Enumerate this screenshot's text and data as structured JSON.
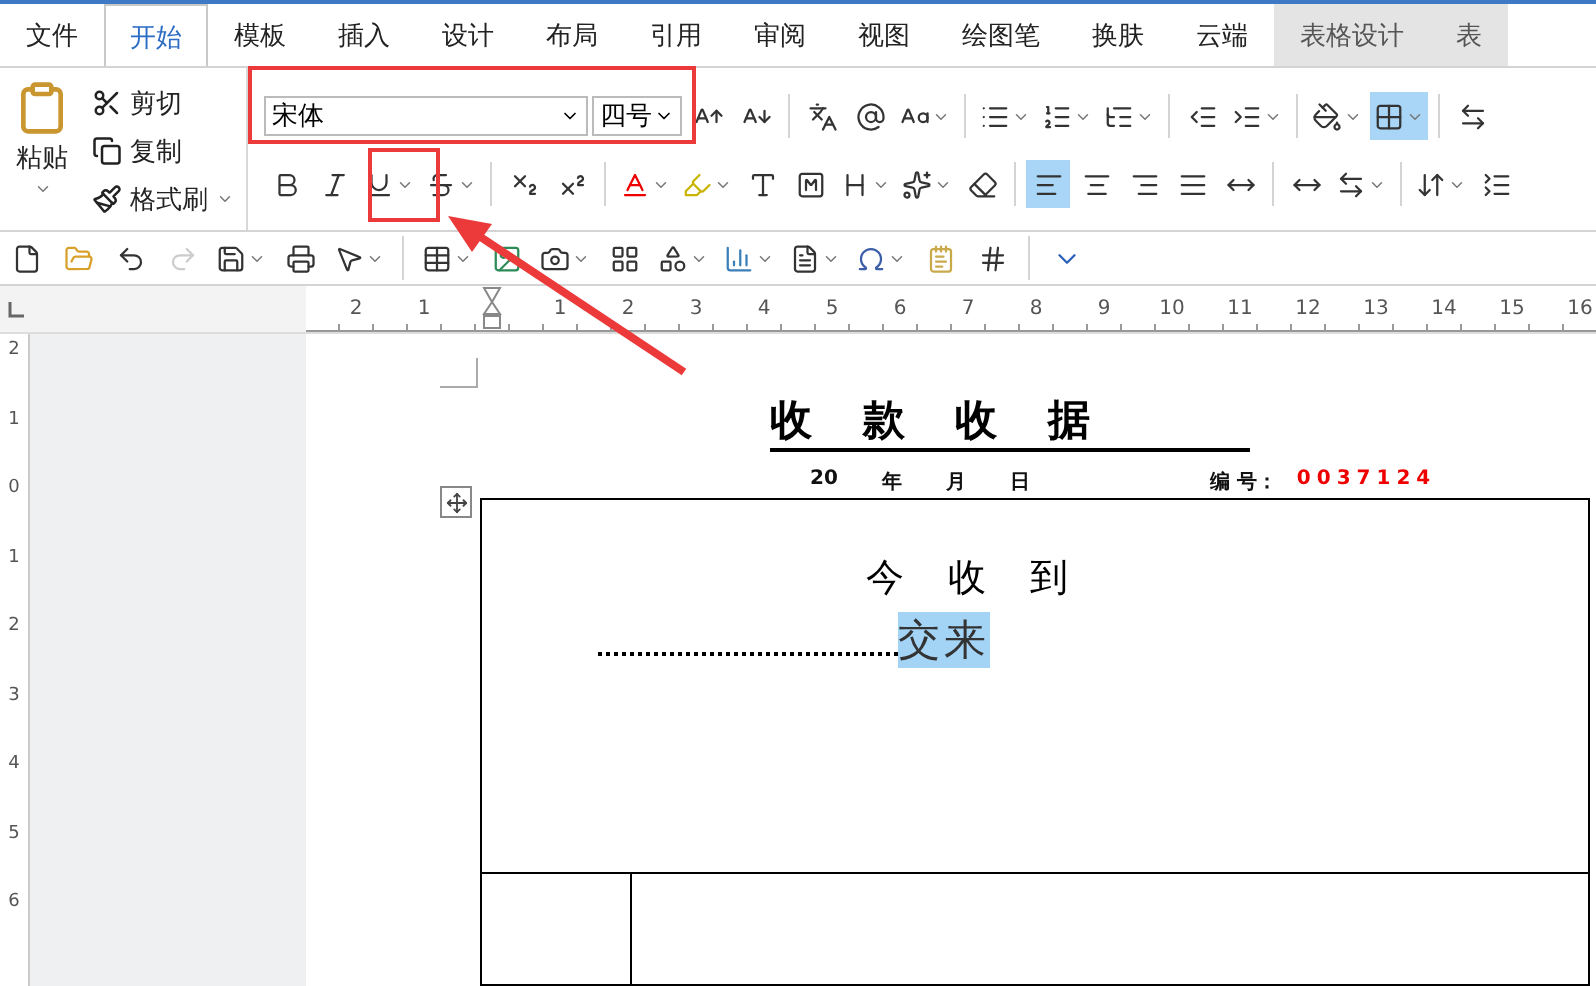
{
  "tabs": [
    {
      "label": "文件",
      "selected": false,
      "context": false
    },
    {
      "label": "开始",
      "selected": true,
      "context": false
    },
    {
      "label": "模板",
      "selected": false,
      "context": false
    },
    {
      "label": "插入",
      "selected": false,
      "context": false
    },
    {
      "label": "设计",
      "selected": false,
      "context": false
    },
    {
      "label": "布局",
      "selected": false,
      "context": false
    },
    {
      "label": "引用",
      "selected": false,
      "context": false
    },
    {
      "label": "审阅",
      "selected": false,
      "context": false
    },
    {
      "label": "视图",
      "selected": false,
      "context": false
    },
    {
      "label": "绘图笔",
      "selected": false,
      "context": false
    },
    {
      "label": "换肤",
      "selected": false,
      "context": false
    },
    {
      "label": "云端",
      "selected": false,
      "context": false
    },
    {
      "label": "表格设计",
      "selected": false,
      "context": true
    },
    {
      "label": "表",
      "selected": false,
      "context": true
    }
  ],
  "clipboard": {
    "paste": "粘贴",
    "cut": "剪切",
    "copy": "复制",
    "format_painter": "格式刷"
  },
  "font": {
    "name": "宋体",
    "size": "四号"
  },
  "tools_row1": [
    {
      "kind": "grow",
      "on": false,
      "dropdown": false
    },
    {
      "kind": "shrink",
      "on": false,
      "dropdown": false
    },
    {
      "kind": "sep"
    },
    {
      "kind": "phonetic",
      "on": false,
      "dropdown": false
    },
    {
      "kind": "circled",
      "on": false,
      "dropdown": false
    },
    {
      "kind": "case",
      "on": false,
      "dropdown": true
    },
    {
      "kind": "sep"
    },
    {
      "kind": "bullets",
      "on": false,
      "dropdown": true
    },
    {
      "kind": "numbering",
      "on": false,
      "dropdown": true
    },
    {
      "kind": "multilevel",
      "on": false,
      "dropdown": true
    },
    {
      "kind": "sep"
    },
    {
      "kind": "outdent",
      "on": false,
      "dropdown": false
    },
    {
      "kind": "indent",
      "on": false,
      "dropdown": true
    },
    {
      "kind": "sep"
    },
    {
      "kind": "shading",
      "on": false,
      "dropdown": true
    },
    {
      "kind": "borders",
      "on": true,
      "dropdown": true
    },
    {
      "kind": "sep"
    },
    {
      "kind": "tabs",
      "on": false,
      "dropdown": false
    }
  ],
  "tools_row2": [
    {
      "kind": "bold",
      "on": false,
      "dropdown": false
    },
    {
      "kind": "italic",
      "on": false,
      "dropdown": false
    },
    {
      "kind": "underline",
      "on": false,
      "dropdown": true
    },
    {
      "kind": "strike",
      "on": false,
      "dropdown": true
    },
    {
      "kind": "sep"
    },
    {
      "kind": "subscript",
      "on": false,
      "dropdown": false
    },
    {
      "kind": "superscript",
      "on": false,
      "dropdown": false
    },
    {
      "kind": "sep"
    },
    {
      "kind": "font-color",
      "on": false,
      "dropdown": true
    },
    {
      "kind": "highlight",
      "on": false,
      "dropdown": true
    },
    {
      "kind": "char-shading",
      "on": false,
      "dropdown": false
    },
    {
      "kind": "char-border",
      "on": false,
      "dropdown": false
    },
    {
      "kind": "emphasis",
      "on": false,
      "dropdown": true
    },
    {
      "kind": "effects",
      "on": false,
      "dropdown": true
    },
    {
      "kind": "clear",
      "on": false,
      "dropdown": false
    },
    {
      "kind": "sep"
    },
    {
      "kind": "align-left",
      "on": true,
      "dropdown": false
    },
    {
      "kind": "align-center",
      "on": false,
      "dropdown": false
    },
    {
      "kind": "align-right",
      "on": false,
      "dropdown": false
    },
    {
      "kind": "justify",
      "on": false,
      "dropdown": false
    },
    {
      "kind": "distribute",
      "on": false,
      "dropdown": false
    },
    {
      "kind": "sep"
    },
    {
      "kind": "char-width",
      "on": false,
      "dropdown": false
    },
    {
      "kind": "text-direction",
      "on": false,
      "dropdown": true
    },
    {
      "kind": "sep"
    },
    {
      "kind": "line-spacing",
      "on": false,
      "dropdown": true
    },
    {
      "kind": "para-spacing",
      "on": false,
      "dropdown": false
    }
  ],
  "quick_toolbar": [
    {
      "kind": "new",
      "dropdown": false
    },
    {
      "kind": "open",
      "dropdown": false
    },
    {
      "kind": "undo",
      "dropdown": false
    },
    {
      "kind": "redo",
      "dropdown": false,
      "disabled": true
    },
    {
      "kind": "save",
      "dropdown": true
    },
    {
      "kind": "print",
      "dropdown": false
    },
    {
      "kind": "select",
      "dropdown": true
    },
    {
      "kind": "sep"
    },
    {
      "kind": "table",
      "dropdown": true
    },
    {
      "kind": "picture",
      "dropdown": false
    },
    {
      "kind": "screenshot",
      "dropdown": true
    },
    {
      "kind": "gallery",
      "dropdown": false
    },
    {
      "kind": "shapes",
      "dropdown": true
    },
    {
      "kind": "chart",
      "dropdown": true
    },
    {
      "kind": "textbox",
      "dropdown": true
    },
    {
      "kind": "symbol",
      "dropdown": true
    },
    {
      "kind": "note",
      "dropdown": false
    },
    {
      "kind": "numbers",
      "dropdown": false
    },
    {
      "kind": "sep"
    },
    {
      "kind": "more",
      "dropdown": false
    }
  ],
  "ruler": {
    "left_numbers": [
      "2",
      "1"
    ],
    "numbers": [
      "1",
      "2",
      "3",
      "4",
      "5",
      "6",
      "7",
      "8",
      "9",
      "10",
      "11",
      "12",
      "13",
      "14",
      "15",
      "16"
    ]
  },
  "vertical_ruler": [
    "2",
    "1",
    "0",
    "1",
    "2",
    "3",
    "4",
    "5",
    "6"
  ],
  "document": {
    "title": "收 款 收 据",
    "date_parts": [
      "20",
      "年",
      "月",
      "日"
    ],
    "number_label": "编 号：",
    "number_value": "0037124",
    "received": "今 收 到",
    "runs": [
      {
        "kind": "leader"
      },
      {
        "kind": "text",
        "text": "交来",
        "selected": true
      }
    ]
  },
  "annotations": [
    {
      "kind": "box"
    },
    {
      "kind": "box"
    },
    {
      "kind": "arrow"
    }
  ]
}
